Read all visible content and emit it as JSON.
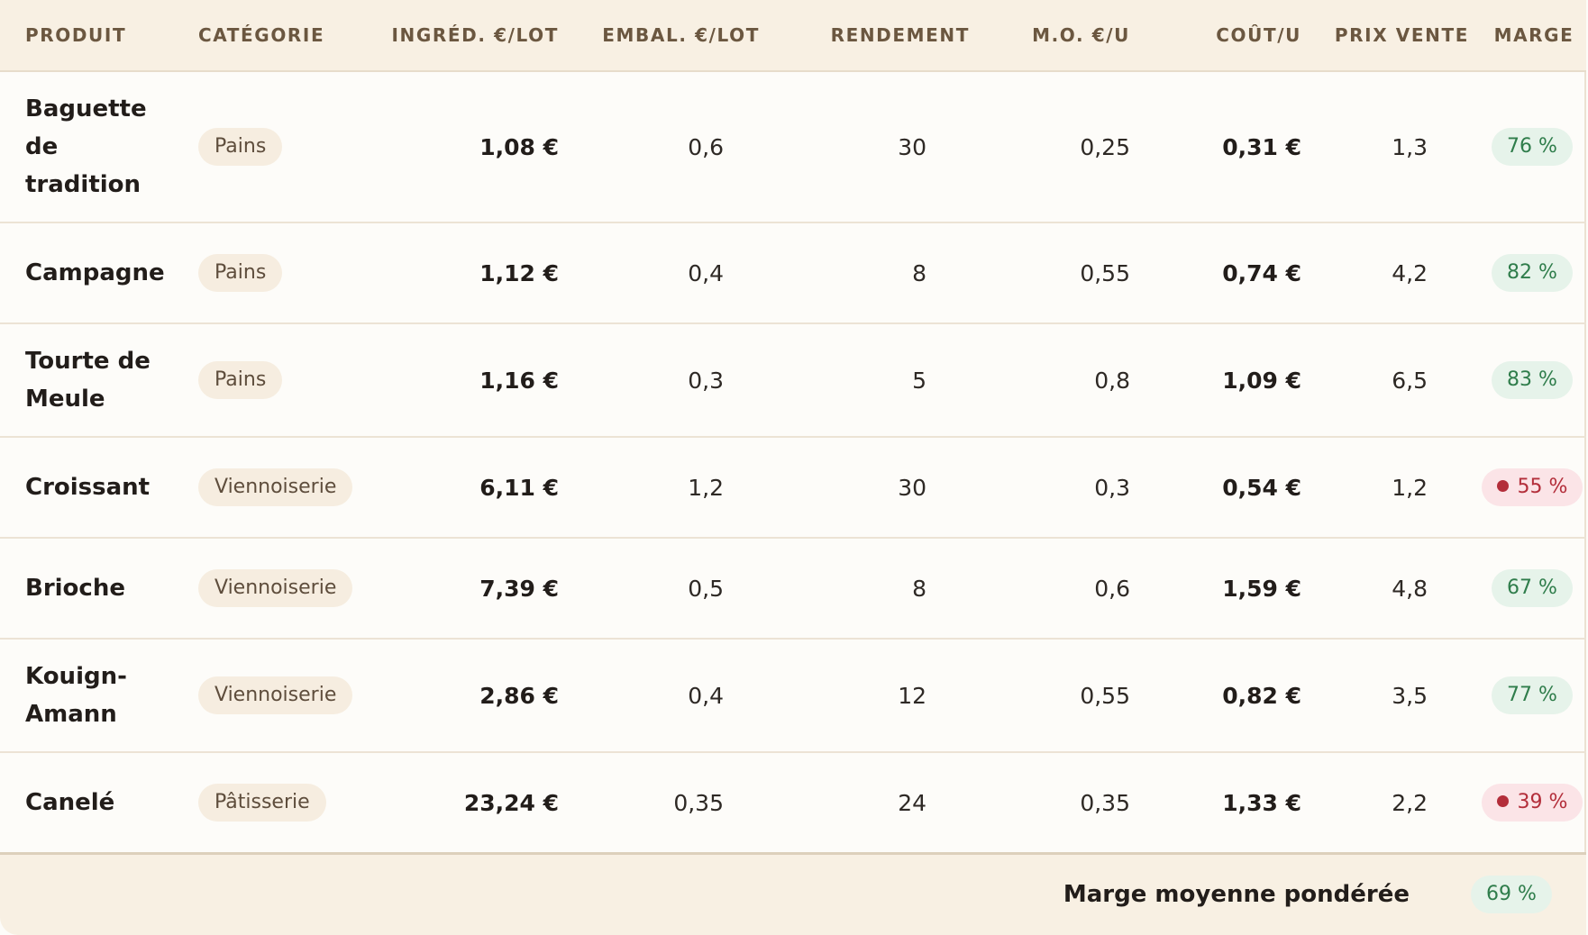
{
  "headers": {
    "produit": "PRODUIT",
    "categorie": "CATÉGORIE",
    "ingredients": "INGRÉD. €/LOT",
    "emballage": "EMBAL. €/LOT",
    "rendement": "RENDEMENT",
    "main_oeuvre": "M.O. €/U",
    "cout": "COÛT/U",
    "prix": "PRIX VENTE",
    "marge": "MARGE"
  },
  "rows": [
    {
      "produit": "Baguette de tradition",
      "categorie": "Pains",
      "ingredients": "1,08 €",
      "emballage": "0,6",
      "rendement": "30",
      "main_oeuvre": "0,25",
      "cout": "0,31 €",
      "prix": "1,3",
      "marge": "76 %",
      "marge_status": "good"
    },
    {
      "produit": "Campagne",
      "categorie": "Pains",
      "ingredients": "1,12 €",
      "emballage": "0,4",
      "rendement": "8",
      "main_oeuvre": "0,55",
      "cout": "0,74 €",
      "prix": "4,2",
      "marge": "82 %",
      "marge_status": "good"
    },
    {
      "produit": "Tourte de Meule",
      "categorie": "Pains",
      "ingredients": "1,16 €",
      "emballage": "0,3",
      "rendement": "5",
      "main_oeuvre": "0,8",
      "cout": "1,09 €",
      "prix": "6,5",
      "marge": "83 %",
      "marge_status": "good"
    },
    {
      "produit": "Croissant",
      "categorie": "Viennoiserie",
      "ingredients": "6,11 €",
      "emballage": "1,2",
      "rendement": "30",
      "main_oeuvre": "0,3",
      "cout": "0,54 €",
      "prix": "1,2",
      "marge": "55 %",
      "marge_status": "bad"
    },
    {
      "produit": "Brioche",
      "categorie": "Viennoiserie",
      "ingredients": "7,39 €",
      "emballage": "0,5",
      "rendement": "8",
      "main_oeuvre": "0,6",
      "cout": "1,59 €",
      "prix": "4,8",
      "marge": "67 %",
      "marge_status": "good"
    },
    {
      "produit": "Kouign-Amann",
      "categorie": "Viennoiserie",
      "ingredients": "2,86 €",
      "emballage": "0,4",
      "rendement": "12",
      "main_oeuvre": "0,55",
      "cout": "0,82 €",
      "prix": "3,5",
      "marge": "77 %",
      "marge_status": "good"
    },
    {
      "produit": "Canelé",
      "categorie": "Pâtisserie",
      "ingredients": "23,24 €",
      "emballage": "0,35",
      "rendement": "24",
      "main_oeuvre": "0,35",
      "cout": "1,33 €",
      "prix": "2,2",
      "marge": "39 %",
      "marge_status": "bad"
    }
  ],
  "footer": {
    "label": "Marge moyenne pondérée",
    "value": "69 %",
    "value_status": "good"
  },
  "colors": {
    "good_bg": "#e6f3ea",
    "good_text": "#2f7d4b",
    "bad_bg": "#fbe4e7",
    "bad_text": "#b32e3a",
    "header_bg": "#f8f0e3",
    "pill_bg": "#f6ede0"
  },
  "icons": {
    "alert": "alert-dot-icon"
  }
}
